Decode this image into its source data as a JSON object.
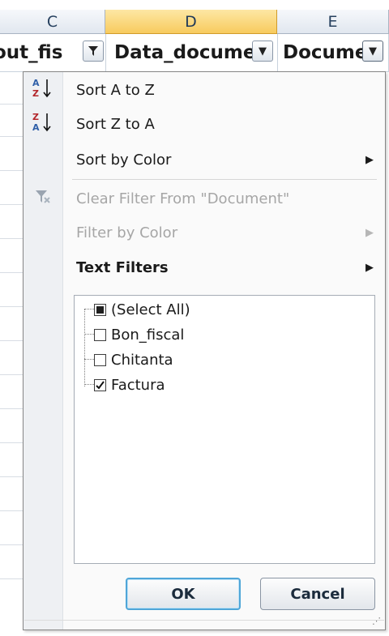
{
  "columns": [
    {
      "letter": "C"
    },
    {
      "letter": "D"
    },
    {
      "letter": "E"
    }
  ],
  "fields": {
    "col_c": "out_fis",
    "col_d": "Data_docume",
    "col_e": "Docume"
  },
  "menu": {
    "sort_az": "Sort A to Z",
    "sort_za": "Sort Z to A",
    "sort_color": "Sort by Color",
    "clear_filter": "Clear Filter From \"Document\"",
    "filter_color": "Filter by Color",
    "text_filters": "Text Filters",
    "az_icon_text": "A\nZ",
    "za_icon_text": "Z\nA"
  },
  "list": {
    "items": [
      {
        "label": "(Select All)",
        "state": "partial"
      },
      {
        "label": "Bon_fiscal",
        "state": "unchecked"
      },
      {
        "label": "Chitanta",
        "state": "unchecked"
      },
      {
        "label": "Factura",
        "state": "checked"
      }
    ]
  },
  "buttons": {
    "ok": "OK",
    "cancel": "Cancel"
  },
  "colors": {
    "selected_column": "#f8cb5e",
    "ok_focus_border": "#4fa6d8"
  },
  "icons": {
    "dropdown": "chevron-down-icon",
    "filter_applied": "filter-icon",
    "submenu": "triangle-right-icon",
    "clear_filter": "clear-filter-icon"
  }
}
